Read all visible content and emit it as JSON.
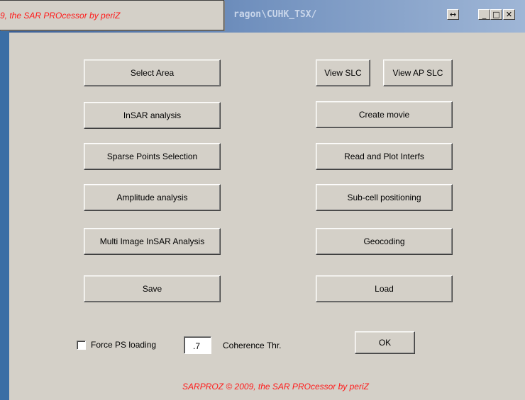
{
  "window": {
    "title_path": "ragon\\CUHK_TSX/",
    "resize_glyph": "↔",
    "min_glyph": "_",
    "max_glyph": "□",
    "close_glyph": "✕"
  },
  "popup": {
    "text": "9, the SAR PROcessor by periZ"
  },
  "left_buttons": {
    "select_area": "Select Area",
    "insar_analysis": "InSAR analysis",
    "sparse_points": "Sparse Points Selection",
    "amplitude_analysis": "Amplitude analysis",
    "multi_image": "Multi Image InSAR Analysis",
    "save": "Save"
  },
  "right_buttons": {
    "view_slc": "View SLC",
    "view_ap_slc": "View AP SLC",
    "create_movie": "Create movie",
    "read_plot": "Read and Plot Interfs",
    "subcell": "Sub-cell positioning",
    "geocoding": "Geocoding",
    "load": "Load"
  },
  "options": {
    "force_ps_label": "Force PS loading",
    "force_ps_checked": false,
    "coherence_value": ".7",
    "coherence_label": "Coherence Thr.",
    "ok_label": "OK"
  },
  "footer": {
    "text": "SARPROZ © 2009, the SAR PROcessor by periZ"
  },
  "colors": {
    "accent_red": "#ff1a1a",
    "face": "#d4d0c8",
    "desktop": "#3a6ea5"
  }
}
